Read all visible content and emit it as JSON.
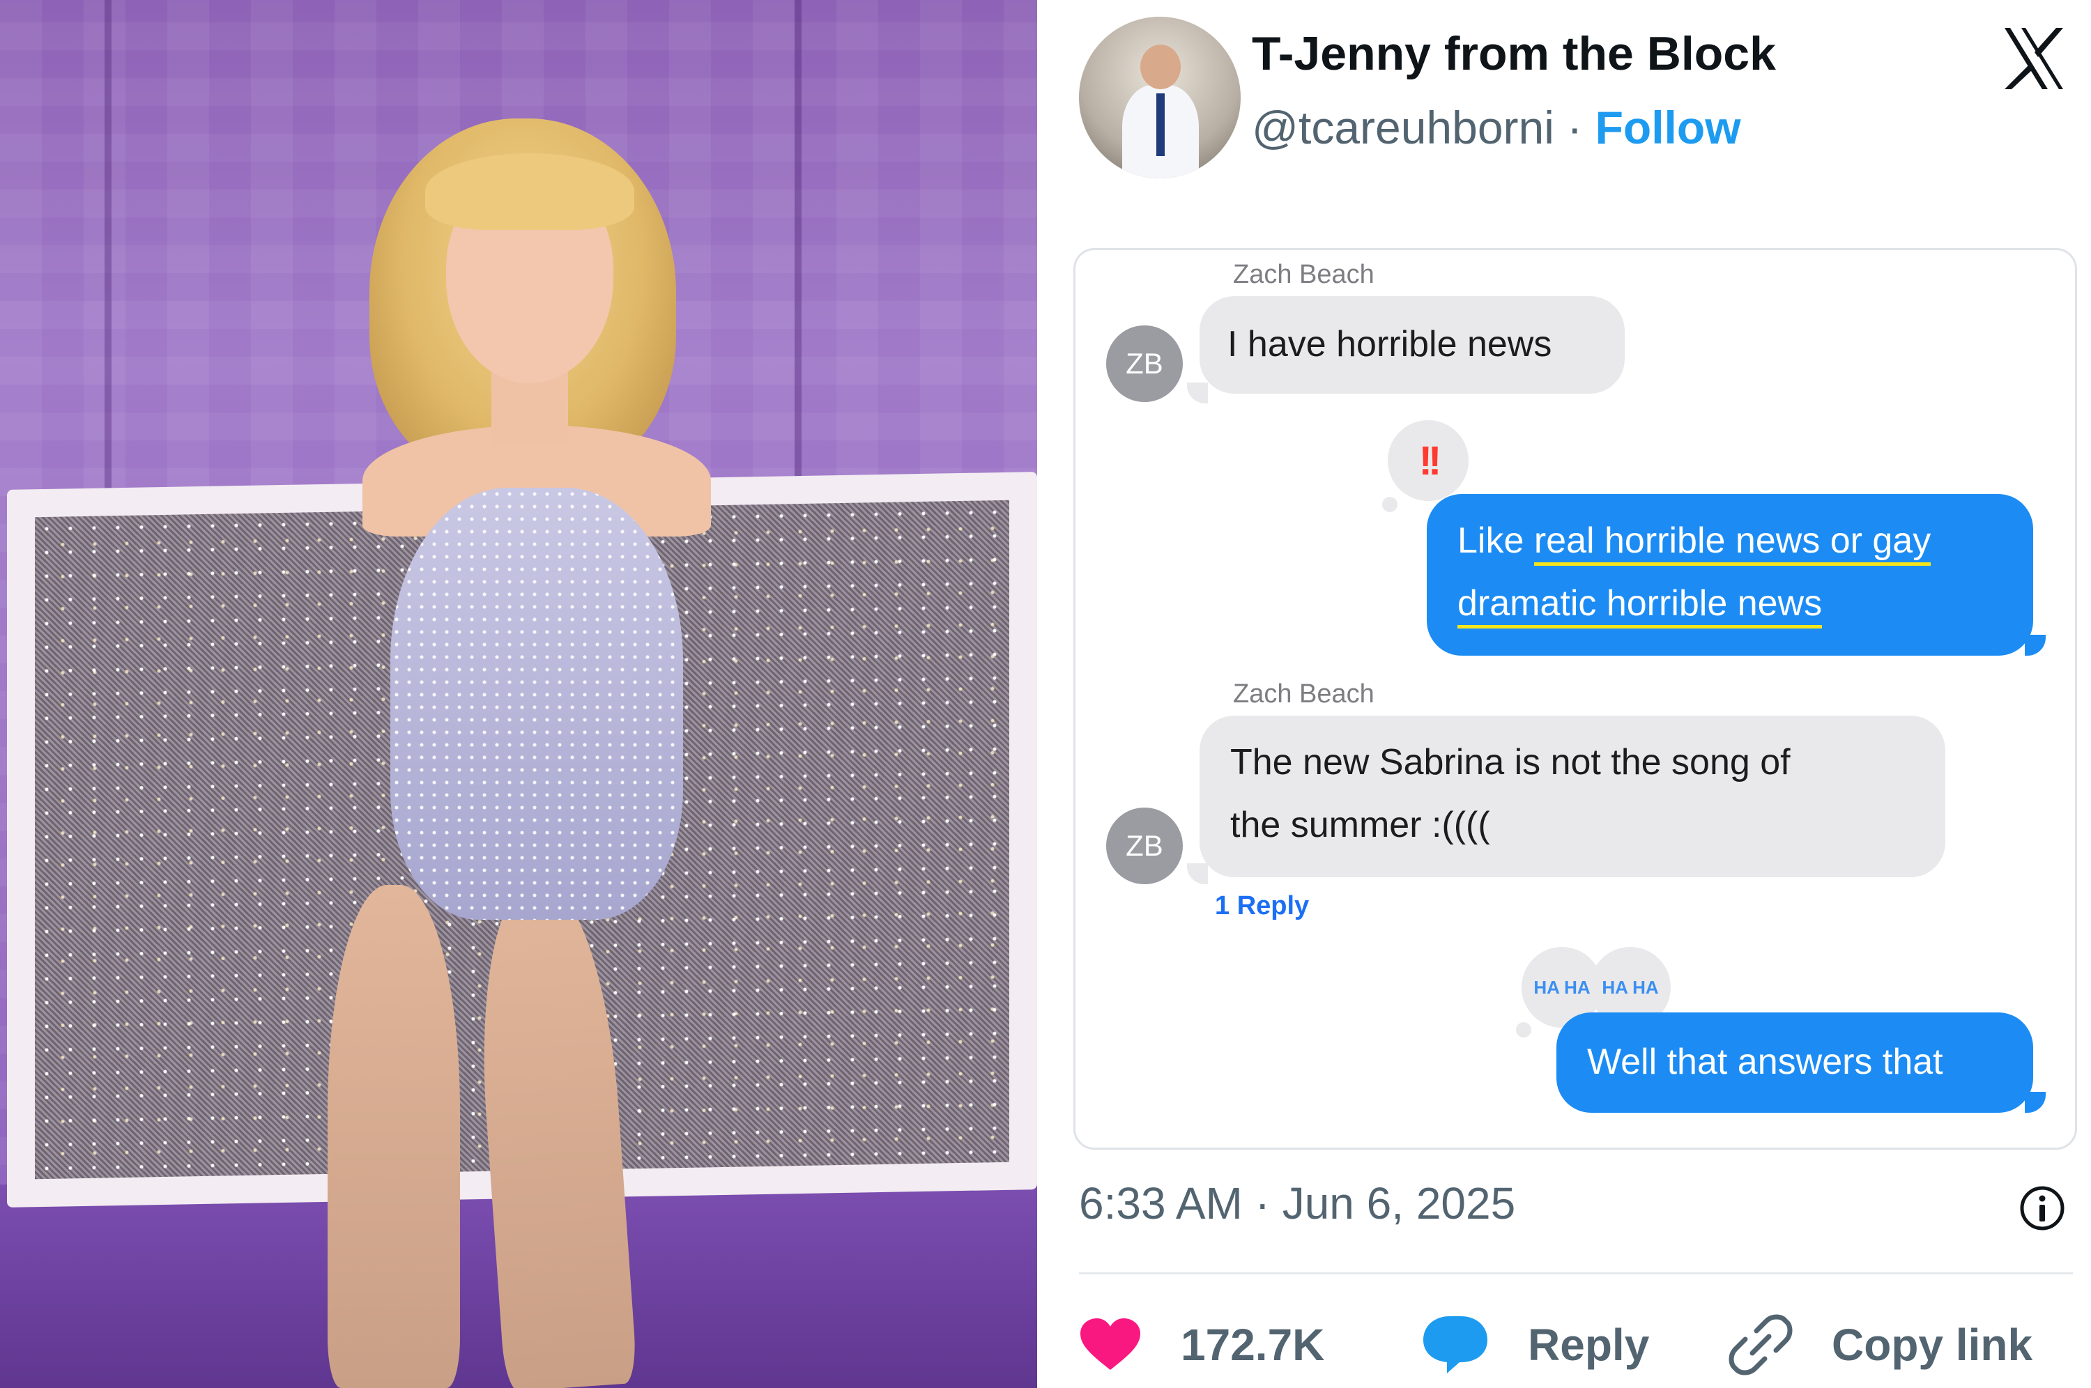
{
  "tweet": {
    "display_name": "T-Jenny from the Block",
    "handle": "@tcareuhborni",
    "separator": "·",
    "follow_label": "Follow",
    "timestamp": "6:33 AM · Jun 6, 2025",
    "likes": "172.7K",
    "reply_label": "Reply",
    "copy_link_label": "Copy link"
  },
  "chat": {
    "messages": [
      {
        "sender": "Zach Beach",
        "avatar": "ZB",
        "text": "I have horrible news"
      },
      {
        "text_part1": "Like ",
        "text_underlined1": "real horrible news or gay",
        "text_underlined2": "dramatic horrible news",
        "tapback": "!!"
      },
      {
        "sender": "Zach Beach",
        "avatar": "ZB",
        "line1": "The new Sabrina is not the song of",
        "line2": "the summer :((((",
        "reply_count": "1 Reply"
      },
      {
        "text": "Well that answers that",
        "tapback": "HA HA"
      }
    ]
  },
  "colors": {
    "link_blue": "#1d9bf0",
    "imessage_blue": "#1c8cf4",
    "like_pink": "#f91880",
    "highlight_yellow": "#f5e51c"
  },
  "icons": [
    "x-logo-icon",
    "info-icon",
    "heart-icon",
    "reply-bubble-icon",
    "link-icon"
  ]
}
